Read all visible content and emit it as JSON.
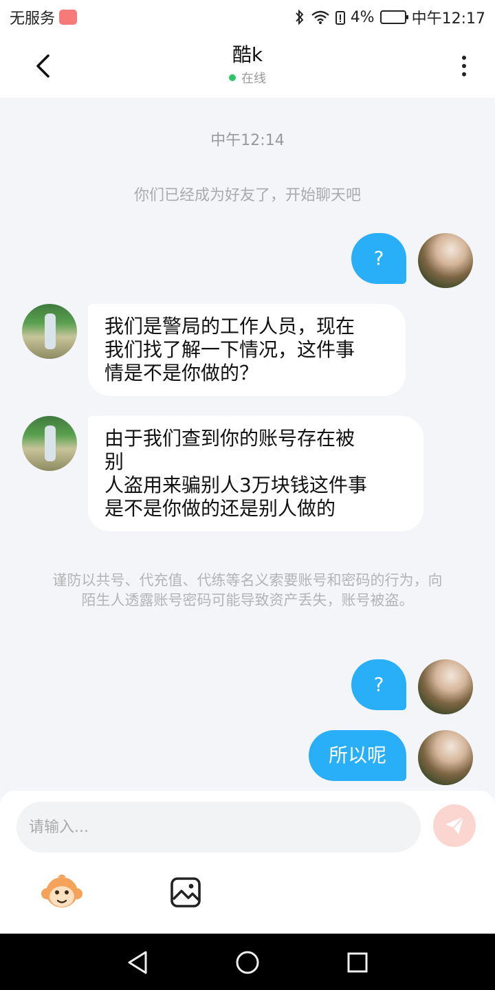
{
  "status_bar": {
    "carrier": "无服务",
    "battery_percent": "4%",
    "time": "中午12:17"
  },
  "header": {
    "title": "酷k",
    "status": "在线"
  },
  "chat": {
    "timestamp": "中午12:14",
    "friend_notice": "你们已经成为好友了，开始聊天吧",
    "messages": [
      {
        "sender": "me",
        "text": "?"
      },
      {
        "sender": "other",
        "text": "我们是警局的工作人员，现在\n我们找了解一下情况，这件事\n情是不是你做的？"
      },
      {
        "sender": "other",
        "text": "由于我们查到你的账号存在被\n别\n人盗用来骗别人3万块钱这件事\n是不是你做的还是别人做的"
      },
      {
        "sender": "me",
        "text": "?"
      },
      {
        "sender": "me",
        "text": "所以呢"
      }
    ],
    "warning": "谨防以共号、代充值、代练等名义索要账号和密码的行为，向陌生人透露账号密码可能导致资产丢失，账号被盗。"
  },
  "input": {
    "placeholder": "请输入..."
  },
  "colors": {
    "my_bubble": "#29aef8",
    "online": "#2ec46a",
    "send_button": "#fbd5cf"
  }
}
